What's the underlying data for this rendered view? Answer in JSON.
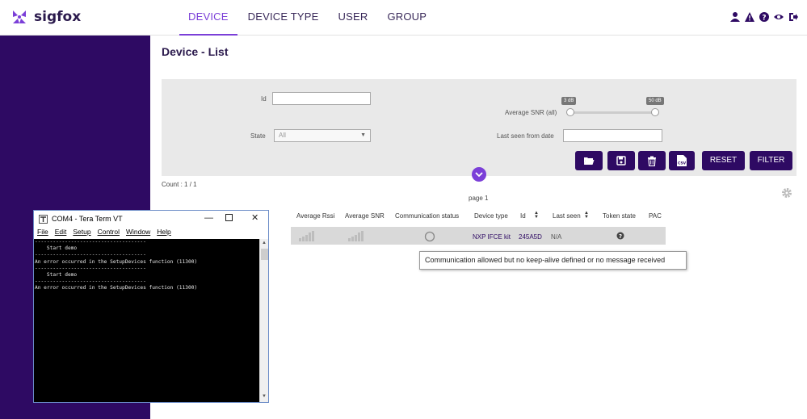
{
  "brand": {
    "name": "sigfox",
    "accent": "#7b3fd8",
    "dark": "#2e0a63"
  },
  "nav": {
    "items": [
      {
        "label": "DEVICE",
        "active": true
      },
      {
        "label": "DEVICE TYPE",
        "active": false
      },
      {
        "label": "USER",
        "active": false
      },
      {
        "label": "GROUP",
        "active": false
      }
    ]
  },
  "top_icons": [
    "user-icon",
    "warning-icon",
    "help-icon",
    "eye-icon",
    "logout-icon"
  ],
  "page": {
    "title": "Device - List"
  },
  "filters": {
    "id_label": "Id",
    "id_value": "",
    "state_label": "State",
    "state_value": "All",
    "snr_label": "Average SNR (all)",
    "snr_min": "3 dB",
    "snr_max": "50 dB",
    "last_seen_label": "Last seen from date",
    "last_seen_value": ""
  },
  "buttons": {
    "reset": "RESET",
    "filter": "FILTER",
    "csv": "CSV"
  },
  "count": "Count : 1 / 1",
  "pager": "page 1",
  "table": {
    "headers": [
      "Average Rssi",
      "Average SNR",
      "Communication status",
      "Device type",
      "Id",
      "Last seen",
      "Token state",
      "PAC"
    ],
    "row": {
      "device_type": "NXP IFCE kit",
      "id": "245A5D",
      "last_seen": "N/A"
    }
  },
  "tooltip": "Communication allowed but no keep-alive defined or no message received",
  "terminal": {
    "title": "COM4 - Tera Term VT",
    "menu": [
      "File",
      "Edit",
      "Setup",
      "Control",
      "Window",
      "Help"
    ],
    "lines": [
      "-------------------------------------",
      "    Start demo",
      "-------------------------------------",
      "An error occurred in the SetupDevices function (11300)",
      "-------------------------------------",
      "    Start demo",
      "-------------------------------------",
      "An error occurred in the SetupDevices function (11300)"
    ]
  }
}
